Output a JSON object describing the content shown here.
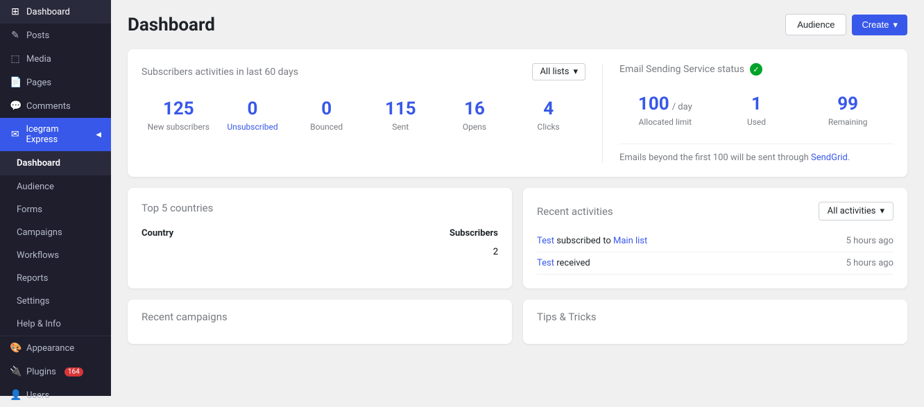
{
  "sidebar": {
    "items": [
      {
        "id": "dashboard-wp",
        "label": "Dashboard",
        "icon": "⊞",
        "active": false
      },
      {
        "id": "posts",
        "label": "Posts",
        "icon": "✎",
        "active": false
      },
      {
        "id": "media",
        "label": "Media",
        "icon": "⬚",
        "active": false
      },
      {
        "id": "pages",
        "label": "Pages",
        "icon": "📄",
        "active": false
      },
      {
        "id": "comments",
        "label": "Comments",
        "icon": "💬",
        "active": false
      },
      {
        "id": "icegram",
        "label": "Icegram Express",
        "icon": "✉",
        "active": true,
        "hasArrow": true
      },
      {
        "id": "icegram-dashboard",
        "label": "Dashboard",
        "icon": "",
        "subItem": true,
        "activeChild": true
      },
      {
        "id": "audience",
        "label": "Audience",
        "icon": "",
        "subItem": true
      },
      {
        "id": "forms",
        "label": "Forms",
        "icon": "",
        "subItem": true
      },
      {
        "id": "campaigns",
        "label": "Campaigns",
        "icon": "",
        "subItem": true
      },
      {
        "id": "workflows",
        "label": "Workflows",
        "icon": "",
        "subItem": true
      },
      {
        "id": "reports",
        "label": "Reports",
        "icon": "",
        "subItem": true
      },
      {
        "id": "settings",
        "label": "Settings",
        "icon": "",
        "subItem": true
      },
      {
        "id": "help",
        "label": "Help & Info",
        "icon": "",
        "subItem": true
      }
    ],
    "bottom_items": [
      {
        "id": "appearance",
        "label": "Appearance",
        "icon": "🎨"
      },
      {
        "id": "plugins",
        "label": "Plugins",
        "icon": "🔌",
        "badge": "164"
      },
      {
        "id": "users",
        "label": "Users",
        "icon": "👤"
      }
    ]
  },
  "header": {
    "title": "Dashboard",
    "audience_btn": "Audience",
    "create_btn": "Create"
  },
  "subscribers_card": {
    "title": "Subscribers activities in last 60 days",
    "dropdown_label": "All lists",
    "stats": [
      {
        "value": "125",
        "label": "New subscribers"
      },
      {
        "value": "0",
        "label": "Unsubscribed",
        "special": true
      },
      {
        "value": "0",
        "label": "Bounced"
      },
      {
        "value": "115",
        "label": "Sent"
      },
      {
        "value": "16",
        "label": "Opens"
      },
      {
        "value": "4",
        "label": "Clicks"
      }
    ]
  },
  "email_service": {
    "title": "Email Sending Service status",
    "status_ok": true,
    "stats": [
      {
        "value": "100",
        "label": "Allocated limit",
        "per_day": "/ day"
      },
      {
        "value": "1",
        "label": "Used"
      },
      {
        "value": "99",
        "label": "Remaining"
      }
    ],
    "note": "Emails beyond the first 100 will be sent through ",
    "sendgrid_label": "SendGrid",
    "sendgrid_url": "#"
  },
  "top_countries": {
    "title": "Top 5 countries",
    "col_country": "Country",
    "col_subscribers": "Subscribers",
    "rows": [
      {
        "country": "",
        "subscribers": "2"
      }
    ]
  },
  "recent_activities": {
    "title": "Recent activities",
    "dropdown_label": "All activities",
    "activities": [
      {
        "link1": "Test",
        "text1": " subscribed to ",
        "link2": "Main list",
        "time": "5 hours ago"
      },
      {
        "link1": "Test",
        "text1": " received",
        "link2": "",
        "time": "5 hours ago"
      }
    ]
  },
  "recent_campaigns": {
    "title": "Recent campaigns"
  },
  "tips": {
    "title": "Tips & Tricks"
  }
}
